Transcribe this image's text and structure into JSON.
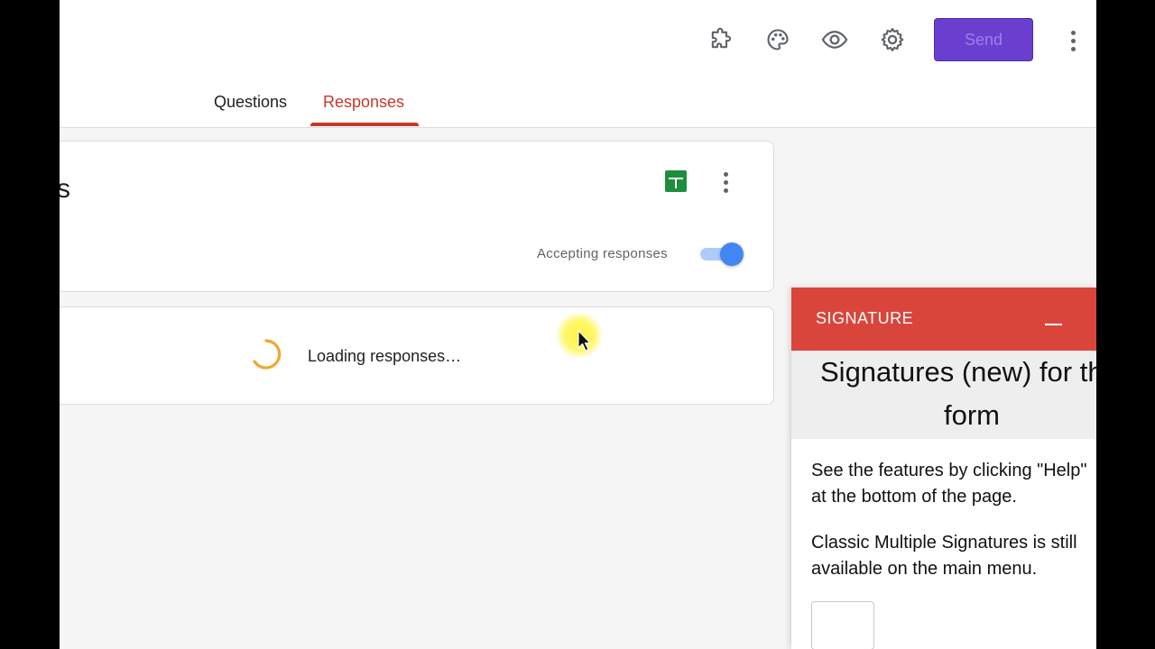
{
  "header": {
    "send_label": "Send",
    "icons": [
      "puzzle-icon",
      "palette-icon",
      "eye-icon",
      "gear-icon",
      "more-vert-icon"
    ]
  },
  "tabs": [
    {
      "label": "Questions",
      "active": false
    },
    {
      "label": "Responses",
      "active": true
    }
  ],
  "summary": {
    "title_fragment": "s",
    "accepting_label": "Accepting responses",
    "accepting_on": true
  },
  "loading": {
    "text": "Loading responses…"
  },
  "signature_panel": {
    "title": "SIGNATURE",
    "hero_line1": "Signatures (new) for this",
    "hero_line2": "form",
    "para1_line1": "See the features by clicking \"Help\"",
    "para1_line2": "at the bottom of the page.",
    "para2_line1": "Classic Multiple Signatures is still",
    "para2_line2": "available on the main menu."
  },
  "colors": {
    "accent_red": "#c5392b",
    "send_purple": "#6a3fd0",
    "signature_red": "#d9453b",
    "toggle_blue": "#4285f4",
    "sheets_green": "#1e8e3e",
    "spinner_orange": "#f0a830"
  }
}
